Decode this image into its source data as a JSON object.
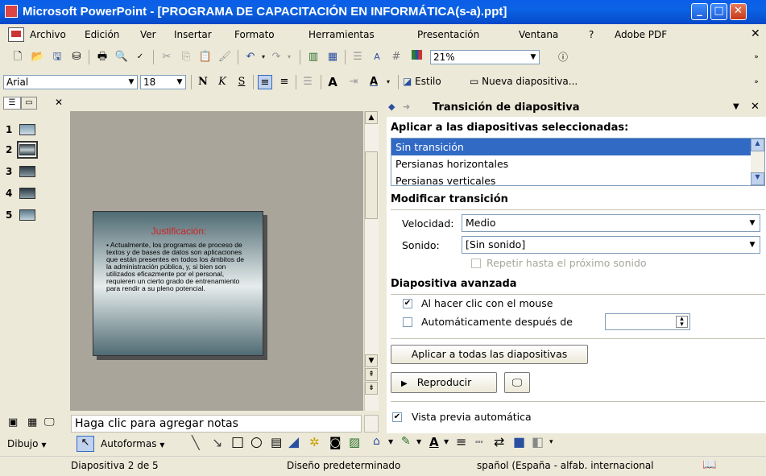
{
  "window": {
    "title": "Microsoft PowerPoint - [PROGRAMA DE CAPACITACIÓN EN INFORMÁTICA(s-a).ppt]"
  },
  "menu": [
    "Archivo",
    "Edición",
    "Ver",
    "Insertar",
    "Formato",
    "Herramientas",
    "Presentación",
    "Ventana",
    "?",
    "Adobe PDF"
  ],
  "standard_toolbar": {
    "zoom": "21%"
  },
  "format_toolbar": {
    "font": "Arial",
    "size": "18",
    "bold": "N",
    "italic": "K",
    "underline": "S",
    "style_label": "Estilo",
    "new_slide_label": "Nueva diapositiva..."
  },
  "slides_pane": {
    "numbers": [
      "1",
      "2",
      "3",
      "4",
      "5"
    ],
    "selected": 2
  },
  "slide": {
    "title": "Justificación:",
    "body": "• Actualmente, los programas de proceso de textos y de bases de datos son aplicaciones que están presentes en todos los ámbitos de la administración pública, y, si bien son utilizados eficazmente por el personal, requieren un cierto grado de entrenamiento para rendir a su pleno potencial."
  },
  "task_pane": {
    "title": "Transición de diapositiva",
    "apply_label": "Aplicar a las diapositivas seleccionadas:",
    "transitions": [
      "Sin transición",
      "Persianas horizontales",
      "Persianas verticales"
    ],
    "modify_header": "Modificar transición",
    "speed_label": "Velocidad:",
    "speed_value": "Medio",
    "sound_label": "Sonido:",
    "sound_value": "[Sin sonido]",
    "loop_label": "Repetir hasta el próximo sonido",
    "advance_header": "Diapositiva avanzada",
    "on_click_label": "Al hacer clic con el mouse",
    "on_click_checked": true,
    "auto_label": "Automáticamente después de",
    "auto_checked": false,
    "apply_all_button": "Aplicar a todas las diapositivas",
    "play_button": "Reproducir",
    "autopreview_label": "Vista previa automática",
    "autopreview_checked": true
  },
  "notes": {
    "placeholder": "Haga clic para agregar notas"
  },
  "drawing_toolbar": {
    "draw_label": "Dibujo",
    "autoshapes_label": "Autoformas"
  },
  "status": {
    "slide": "Diapositiva 2 de 5",
    "design": "Diseño predeterminado",
    "language": "spañol (España - alfab. internacional"
  }
}
